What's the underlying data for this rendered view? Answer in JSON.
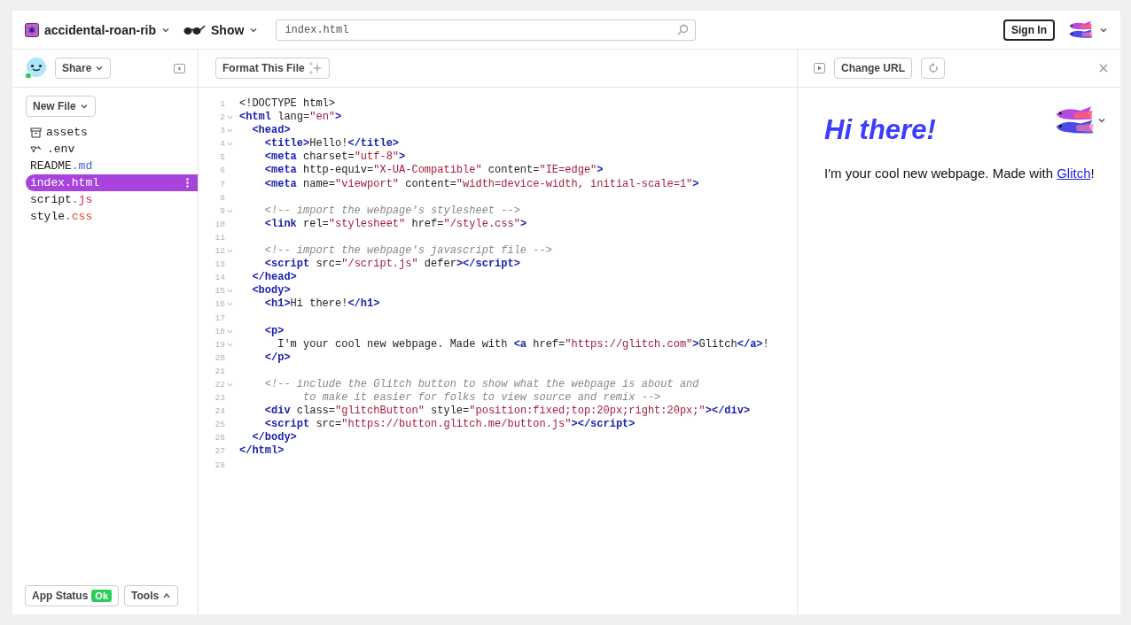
{
  "topbar": {
    "project": "accidental-roan-rib",
    "show": "Show",
    "url": {
      "value": "index.html"
    },
    "sign_in": "Sign In"
  },
  "sidebar": {
    "share": "Share",
    "new_file": "New File",
    "files": [
      {
        "kind": "folder",
        "name": "assets",
        "selected": false
      },
      {
        "kind": "env",
        "name": ".env",
        "selected": false
      },
      {
        "kind": "file",
        "name": "README",
        "ext": ".md",
        "color": "#3a5bd9",
        "selected": false
      },
      {
        "kind": "file",
        "name": "index",
        "ext": ".html",
        "selected": true
      },
      {
        "kind": "file",
        "name": "script",
        "ext": ".js",
        "color": "#d1246b",
        "selected": false
      },
      {
        "kind": "file",
        "name": "style",
        "ext": ".css",
        "color": "#e0452b",
        "selected": false
      }
    ],
    "app_status": "App Status",
    "status_badge": "Ok",
    "tools": "Tools"
  },
  "editor": {
    "format_button": "Format This File",
    "lines": [
      {
        "number": "1",
        "foldable": false,
        "tokens": [
          {
            "kind": "text",
            "text": "<!DOCTYPE html>"
          }
        ]
      },
      {
        "number": "2",
        "foldable": true,
        "tokens": [
          {
            "kind": "tag",
            "text": "<html"
          },
          {
            "kind": "text",
            "text": " lang="
          },
          {
            "kind": "string",
            "text": "\"en\""
          },
          {
            "kind": "tag",
            "text": ">"
          }
        ]
      },
      {
        "number": "3",
        "foldable": true,
        "tokens": [
          {
            "kind": "tag",
            "text": "  <head>"
          }
        ]
      },
      {
        "number": "4",
        "foldable": true,
        "tokens": [
          {
            "kind": "tag",
            "text": "    <title>"
          },
          {
            "kind": "text",
            "text": "Hello!"
          },
          {
            "kind": "tag",
            "text": "</title>"
          }
        ]
      },
      {
        "number": "5",
        "foldable": false,
        "tokens": [
          {
            "kind": "tag",
            "text": "    <meta"
          },
          {
            "kind": "text",
            "text": " charset="
          },
          {
            "kind": "string",
            "text": "\"utf-8\""
          },
          {
            "kind": "tag",
            "text": ">"
          }
        ]
      },
      {
        "number": "6",
        "foldable": false,
        "tokens": [
          {
            "kind": "tag",
            "text": "    <meta"
          },
          {
            "kind": "text",
            "text": " http-equiv="
          },
          {
            "kind": "string",
            "text": "\"X-UA-Compatible\""
          },
          {
            "kind": "text",
            "text": " content="
          },
          {
            "kind": "string",
            "text": "\"IE=edge\""
          },
          {
            "kind": "tag",
            "text": ">"
          }
        ]
      },
      {
        "number": "7",
        "foldable": false,
        "tokens": [
          {
            "kind": "tag",
            "text": "    <meta"
          },
          {
            "kind": "text",
            "text": " name="
          },
          {
            "kind": "string",
            "text": "\"viewport\""
          },
          {
            "kind": "text",
            "text": " content="
          },
          {
            "kind": "string",
            "text": "\"width=device-width, initial-scale=1\""
          },
          {
            "kind": "tag",
            "text": ">"
          }
        ]
      },
      {
        "number": "8",
        "foldable": false
      },
      {
        "number": "9",
        "foldable": true,
        "tokens": [
          {
            "kind": "comment",
            "text": "    <!-- import the webpage's stylesheet -->"
          }
        ]
      },
      {
        "number": "10",
        "foldable": false,
        "tokens": [
          {
            "kind": "tag",
            "text": "    <link"
          },
          {
            "kind": "text",
            "text": " rel="
          },
          {
            "kind": "string",
            "text": "\"stylesheet\""
          },
          {
            "kind": "text",
            "text": " href="
          },
          {
            "kind": "string",
            "text": "\"/style.css\""
          },
          {
            "kind": "tag",
            "text": ">"
          }
        ]
      },
      {
        "number": "11",
        "foldable": false
      },
      {
        "number": "12",
        "foldable": true,
        "tokens": [
          {
            "kind": "comment",
            "text": "    <!-- import the webpage's javascript file -->"
          }
        ]
      },
      {
        "number": "13",
        "foldable": false,
        "tokens": [
          {
            "kind": "tag",
            "text": "    <script"
          },
          {
            "kind": "text",
            "text": " src="
          },
          {
            "kind": "string",
            "text": "\"/script.js\""
          },
          {
            "kind": "text",
            "text": " defer"
          },
          {
            "kind": "tag",
            "text": "></script>"
          }
        ]
      },
      {
        "number": "14",
        "foldable": false,
        "tokens": [
          {
            "kind": "tag",
            "text": "  </head>"
          }
        ]
      },
      {
        "number": "15",
        "foldable": true,
        "tokens": [
          {
            "kind": "tag",
            "text": "  <body>"
          }
        ]
      },
      {
        "number": "16",
        "foldable": true,
        "tokens": [
          {
            "kind": "tag",
            "text": "    <h1>"
          },
          {
            "kind": "text",
            "text": "Hi there!"
          },
          {
            "kind": "tag",
            "text": "</h1>"
          }
        ]
      },
      {
        "number": "17",
        "foldable": false
      },
      {
        "number": "18",
        "foldable": true,
        "tokens": [
          {
            "kind": "tag",
            "text": "    <p>"
          }
        ]
      },
      {
        "number": "19",
        "foldable": true,
        "tokens": [
          {
            "kind": "text",
            "text": "      I'm your cool new webpage. Made with "
          },
          {
            "kind": "tag",
            "text": "<a"
          },
          {
            "kind": "text",
            "text": " href="
          },
          {
            "kind": "string",
            "text": "\"https://glitch.com\""
          },
          {
            "kind": "tag",
            "text": ">"
          },
          {
            "kind": "text",
            "text": "Glitch"
          },
          {
            "kind": "tag",
            "text": "</a>"
          },
          {
            "kind": "text",
            "text": "!"
          }
        ]
      },
      {
        "number": "20",
        "foldable": false,
        "tokens": [
          {
            "kind": "tag",
            "text": "    </p>"
          }
        ]
      },
      {
        "number": "21",
        "foldable": false
      },
      {
        "number": "22",
        "foldable": true,
        "tokens": [
          {
            "kind": "comment",
            "text": "    <!-- include the Glitch button to show what the webpage is about and"
          }
        ]
      },
      {
        "number": "23",
        "foldable": false,
        "tokens": [
          {
            "kind": "comment",
            "text": "          to make it easier for folks to view source and remix -->"
          }
        ]
      },
      {
        "number": "24",
        "foldable": false,
        "tokens": [
          {
            "kind": "tag",
            "text": "    <div"
          },
          {
            "kind": "text",
            "text": " class="
          },
          {
            "kind": "string",
            "text": "\"glitchButton\""
          },
          {
            "kind": "text",
            "text": " style="
          },
          {
            "kind": "string",
            "text": "\"position:fixed;top:20px;right:20px;\""
          },
          {
            "kind": "tag",
            "text": "></div>"
          }
        ]
      },
      {
        "number": "25",
        "foldable": false,
        "tokens": [
          {
            "kind": "tag",
            "text": "    <script"
          },
          {
            "kind": "text",
            "text": " src="
          },
          {
            "kind": "string",
            "text": "\"https://button.glitch.me/button.js\""
          },
          {
            "kind": "tag",
            "text": "></script>"
          }
        ]
      },
      {
        "number": "26",
        "foldable": false,
        "tokens": [
          {
            "kind": "tag",
            "text": "  </body>"
          }
        ]
      },
      {
        "number": "27",
        "foldable": false,
        "tokens": [
          {
            "kind": "tag",
            "text": "</html>"
          }
        ]
      },
      {
        "number": "28",
        "foldable": false
      }
    ]
  },
  "preview": {
    "change_url": "Change URL",
    "heading": "Hi there!",
    "paragraph": {
      "text": "I'm your cool new webpage. Made with ",
      "link": "Glitch",
      "after": "!"
    }
  }
}
